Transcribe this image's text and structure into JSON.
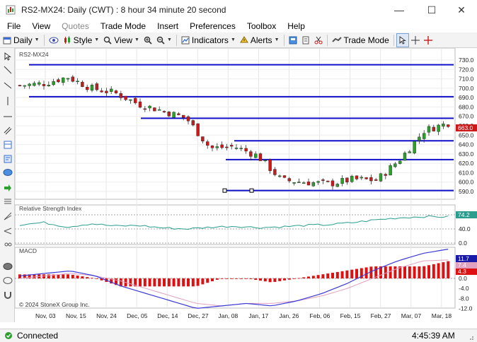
{
  "window": {
    "title": "RS2-MX24: Daily (CWT) : 8 hour 34 minute 20 second"
  },
  "menu": [
    "File",
    "View",
    "Quotes",
    "Trade Mode",
    "Insert",
    "Preferences",
    "Toolbox",
    "Help"
  ],
  "menu_disabled": [
    "Quotes"
  ],
  "toolbar": {
    "interval": "Daily",
    "style_label": "Style",
    "view_label": "View",
    "indicators_label": "Indicators",
    "alerts_label": "Alerts",
    "trade_mode_label": "Trade Mode"
  },
  "panels": {
    "price_label": "RS2-MX24",
    "rsi_label": "Relative Strength Index",
    "macd_label": "MACD",
    "copyright": "© 2024 StoneX Group Inc."
  },
  "price_axis": [
    "730.0",
    "720.0",
    "710.0",
    "700.0",
    "690.0",
    "680.0",
    "670.0",
    "660.0",
    "650.0",
    "640.0",
    "630.0",
    "620.0",
    "610.0",
    "600.0",
    "590.0"
  ],
  "rsi_axis": [
    "80.0",
    "40.0",
    "0.0"
  ],
  "macd_axis": [
    "4.0",
    "0.0",
    "-4.0",
    "-8.0",
    "-12.0"
  ],
  "date_axis": [
    "Nov, 03",
    "Nov, 15",
    "Nov, 24",
    "Dec, 05",
    "Dec, 14",
    "Dec, 27",
    "Jan, 08",
    "Jan, 17",
    "Jan, 26",
    "Feb, 06",
    "Feb, 15",
    "Feb, 27",
    "Mar, 07",
    "Mar, 18"
  ],
  "badges": {
    "price": "663.0",
    "rsi": "74.2",
    "macd1": "11.7",
    "macd2": "7.4",
    "macd3": "4.3"
  },
  "colors": {
    "up": "#2e9e2e",
    "down": "#cc1a1a",
    "hline": "#1010c8",
    "rsi": "#2a9d8f",
    "macd_line": "#3a3ad8",
    "signal_line": "#e0a0c0",
    "hist": "#dd1111"
  },
  "status": {
    "connection": "Connected",
    "time": "4:45:39 AM"
  },
  "chart_data": [
    {
      "type": "candlestick",
      "title": "RS2-MX24",
      "ylim": [
        585,
        733
      ],
      "x": [
        "Nov, 03",
        "Nov, 15",
        "Nov, 24",
        "Dec, 05",
        "Dec, 14",
        "Dec, 27",
        "Jan, 08",
        "Jan, 17",
        "Jan, 26",
        "Feb, 06",
        "Feb, 15",
        "Feb, 27",
        "Mar, 07",
        "Mar, 18"
      ],
      "close": [
        703,
        705,
        712,
        700,
        695,
        683,
        676,
        668,
        636,
        638,
        628,
        602,
        600,
        598,
        603,
        602,
        625,
        655,
        663
      ],
      "horizontal_levels": [
        725,
        691,
        668,
        644,
        624,
        591
      ]
    },
    {
      "type": "line",
      "title": "Relative Strength Index",
      "ylim": [
        0,
        100
      ],
      "series": [
        {
          "values": [
            52,
            58,
            46,
            55,
            48,
            50,
            43,
            40,
            45,
            48,
            44,
            46,
            50,
            52,
            58,
            66,
            72,
            75,
            74.2
          ]
        }
      ]
    },
    {
      "type": "bar",
      "title": "MACD",
      "ylim": [
        -14,
        13
      ],
      "series": [
        {
          "values": [
            1,
            2,
            3,
            1,
            -3,
            -6,
            -9,
            -12,
            -11,
            -10,
            -11,
            -9,
            -6,
            -2,
            3,
            7,
            10,
            11.7
          ]
        },
        {
          "values": [
            0,
            1,
            2,
            1,
            -1,
            -4,
            -7,
            -10,
            -11,
            -10,
            -10,
            -9,
            -7,
            -4,
            0,
            4,
            7,
            7.4
          ]
        }
      ]
    }
  ]
}
